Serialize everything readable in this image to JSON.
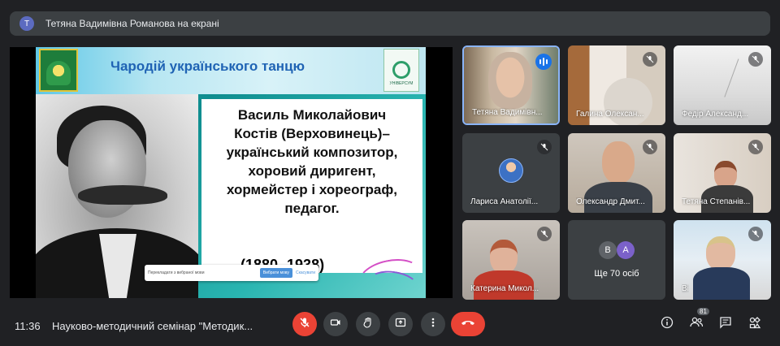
{
  "banner": {
    "avatar_letter": "Т",
    "text": "Тетяна Вадимівна Романова на екрані"
  },
  "slide": {
    "title": "Чародій українського танцю",
    "logo_right_label": "УНІВЕРСУМ",
    "bio": [
      "Василь Миколайович",
      "Костів (Верховинець)–",
      "український композитор,",
      "хоровий диригент,",
      "хормейстер і хореограф,",
      "педагог."
    ],
    "years": "(1880 -1938)",
    "translate_bar": {
      "message": "Перекладати з вибраної мови",
      "primary": "Вибрати мову",
      "secondary": "Скасувати"
    }
  },
  "participants": [
    {
      "name": "Тетяна Вадимівн...",
      "speaking": true,
      "muted": false
    },
    {
      "name": "Галина Олексан...",
      "speaking": false,
      "muted": true
    },
    {
      "name": "Федір Александ...",
      "speaking": false,
      "muted": true
    },
    {
      "name": "Лариса Анатолії...",
      "speaking": false,
      "muted": true
    },
    {
      "name": "Олександр Дмит...",
      "speaking": false,
      "muted": true
    },
    {
      "name": "Тетяна Степанів...",
      "speaking": false,
      "muted": true
    },
    {
      "name": "Катерина Микол...",
      "speaking": false,
      "muted": true
    },
    {
      "name": "Ві",
      "speaking": false,
      "muted": true
    }
  ],
  "more": {
    "letters": [
      "В",
      "А"
    ],
    "text": "Ще 70 осіб"
  },
  "bottom": {
    "clock": "11:36",
    "meeting_title": "Науково-методичний семінар \"Методик...",
    "people_count": "81"
  },
  "colors": {
    "end_call": "#ea4335",
    "active_border": "#8ab4f8",
    "speaking": "#1a73e8"
  }
}
